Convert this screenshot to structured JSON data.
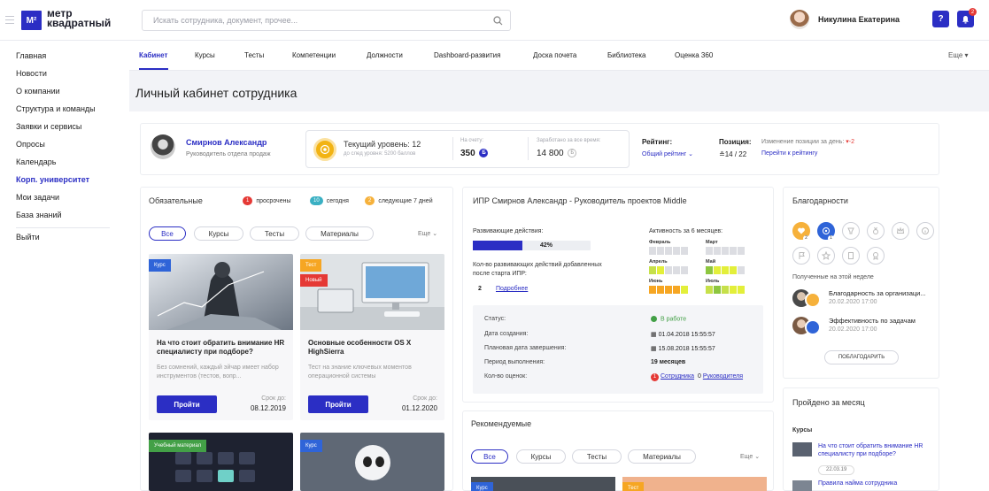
{
  "app": {
    "logo_mark": "M²",
    "logo_line1": "метр",
    "logo_line2": "квадратный"
  },
  "search": {
    "placeholder": "Искать сотрудника, документ, прочее..."
  },
  "user": {
    "name": "Никулина Екатерина",
    "help_label": "?",
    "notifications_count": "2"
  },
  "sidebar": {
    "items": [
      "Главная",
      "Новости",
      "О компании",
      "Структура и команды",
      "Заявки и сервисы",
      "Опросы",
      "Календарь",
      "Корп. университет",
      "Мои задачи",
      "База знаний"
    ],
    "logout": "Выйти"
  },
  "tabs": {
    "items": [
      "Кабинет",
      "Курсы",
      "Тесты",
      "Компетенции",
      "Должности",
      "Dashboard-развития",
      "Доска почета",
      "Библиотека",
      "Оценка 360"
    ],
    "more": "Еще"
  },
  "page": {
    "title": "Личный кабинет сотрудника"
  },
  "profile": {
    "name": "Смирнов Александр",
    "role": "Руководитель отдела продаж",
    "level_title": "Текущий уровень: 12",
    "level_sub": "до след уровня: 5200 баллов",
    "account_label": "На счету:",
    "account_value": "350",
    "earned_label": "Заработано за все время:",
    "earned_value": "14 800",
    "rating_label": "Рейтинг:",
    "rating_select": "Общий рейтинг",
    "position_label": "Позиция:",
    "position_value": "14 / 22",
    "change_label": "Изменение позиции за день:",
    "change_value": "-2",
    "rating_link": "Перейти к рейтингу"
  },
  "mandatory": {
    "title": "Обязательные",
    "legend": [
      {
        "count": "1",
        "label": "просрочены",
        "color": "#e53935"
      },
      {
        "count": "10",
        "label": "сегодня",
        "color": "#3ab0c3"
      },
      {
        "count": "2",
        "label": "следующие 7 дней",
        "color": "#f6b13b"
      }
    ],
    "filters": [
      "Все",
      "Курсы",
      "Тесты",
      "Материалы"
    ],
    "more": "Еще",
    "courses": [
      {
        "tag": "Курс",
        "title": "На что стоит обратить внимание HR специалисту при подборе?",
        "desc": "Без сомнений, каждый эйчар имеет набор инструментов (тестов, вопр...",
        "button": "Пройти",
        "due_label": "Срок до:",
        "due": "08.12.2019"
      },
      {
        "tag": "Тест",
        "tag2": "Новый",
        "title": "Основные особенности OS X HighSierra",
        "desc": "Тест на знание ключевых моментов операционной системы",
        "button": "Пройти",
        "due_label": "Срок до:",
        "due": "01.12.2020"
      },
      {
        "tag": "Учебный материал"
      },
      {
        "tag": "Курс"
      }
    ]
  },
  "ipr": {
    "title": "ИПР Смирнов Александр - Руководитель проектов Middle",
    "dev_label": "Развивающие действия:",
    "progress_pct": 42,
    "progress_text": "42%",
    "count_label": "Кол-во развивающих действий добавленных после старта ИПР:",
    "count_value": "2",
    "details_link": "Подробнее",
    "activity_label": "Активность за 6 месяцев:",
    "months": [
      {
        "name": "Февраль",
        "colors": [
          "#dcdde2",
          "#dcdde2",
          "#dcdde2",
          "#dcdde2",
          "#dcdde2"
        ]
      },
      {
        "name": "Март",
        "colors": [
          "#dcdde2",
          "#dcdde2",
          "#dcdde2",
          "#dcdde2",
          "#dcdde2"
        ]
      },
      {
        "name": "Апрель",
        "colors": [
          "#c6e04a",
          "#e3ef3a",
          "#dcdde2",
          "#dcdde2",
          "#dcdde2"
        ]
      },
      {
        "name": "Май",
        "colors": [
          "#8dc63f",
          "#e3ef3a",
          "#e3ef3a",
          "#e3ef3a",
          "#dcdde2"
        ]
      },
      {
        "name": "Июнь",
        "colors": [
          "#f6a623",
          "#f6a623",
          "#f6a623",
          "#f6a623",
          "#e3ef3a"
        ]
      },
      {
        "name": "Июль",
        "colors": [
          "#c6e04a",
          "#8dc63f",
          "#c6e04a",
          "#e3ef3a",
          "#e3ef3a"
        ]
      }
    ],
    "status_label": "Статус:",
    "status_value": "В работе",
    "created_label": "Дата создания:",
    "created_value": "01.04.2018 15:55:57",
    "planned_label": "Плановая дата завершения:",
    "planned_value": "15.08.2018 15:55:57",
    "period_label": "Период выполнения:",
    "period_value": "19 месяцев",
    "ratings_label": "Кол-во оценок:",
    "ratings_employee_count": "1",
    "ratings_employee": "Сотрудника",
    "ratings_manager_count": "0",
    "ratings_manager": "Руководителя"
  },
  "recommended": {
    "title": "Рекомендуемые",
    "filters": [
      "Все",
      "Курсы",
      "Тесты",
      "Материалы"
    ],
    "more": "Еще",
    "tags": [
      "Курс",
      "Тест"
    ]
  },
  "thanks": {
    "title": "Благодарности",
    "icon_counts": [
      "2",
      "1"
    ],
    "week_label": "Полученные на этой неделе",
    "items": [
      {
        "title": "Благодарность за организаци...",
        "date": "20.02.2020 17:00"
      },
      {
        "title": "Эффективность по задачам",
        "date": "20.02.2020 17:00"
      }
    ],
    "button": "ПОБЛАГОДАРИТЬ"
  },
  "monthly": {
    "title": "Пройдено за месяц",
    "section": "Курсы",
    "items": [
      {
        "title": "На что стоит обратить внимание HR специалисту при подборе?",
        "date": "22.03.19"
      },
      {
        "title": "Правила найма сотрудника"
      }
    ]
  }
}
